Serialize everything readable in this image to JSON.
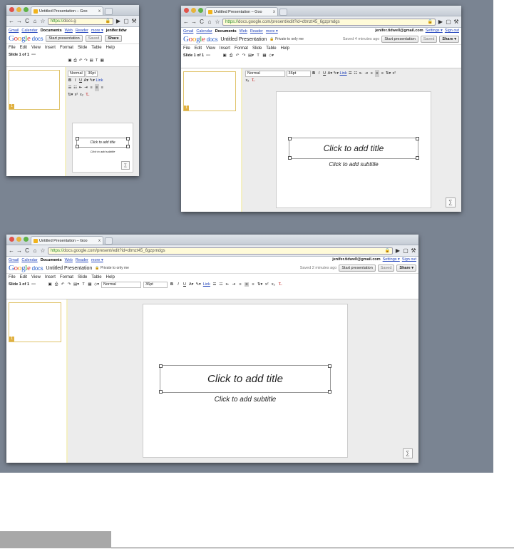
{
  "browser": {
    "tab_title": "Untitled Presentation – Goo",
    "tab_close": "x",
    "url_scheme": "https://",
    "url_short": "docs.g",
    "url_medium": "docs.google.com/present/edit?id=dtmzt45_6gzprndgs",
    "url_long": "docs.google.com/present/edit?id=dtmzt45_6gzprndgs"
  },
  "gbar": {
    "links": [
      "Gmail",
      "Calendar",
      "Documents",
      "Web",
      "Reader",
      "more ▾"
    ],
    "email": "jenifer.tidwell@gmail.com",
    "email_short": "jenifer.tidw",
    "settings": "Settings ▾",
    "sign_out": "Sign out"
  },
  "docs": {
    "logo_google": "Google",
    "logo_docs": "docs",
    "title": "Untitled Presentation",
    "private": "Private to only me",
    "saved_msg_w2": "Saved 4 minutes ago",
    "saved_msg_w3": "Saved 2 minutes ago",
    "start_btn": "Start presentation",
    "saved_btn": "Saved",
    "share_btn": "Share"
  },
  "menu": [
    "File",
    "Edit",
    "View",
    "Insert",
    "Format",
    "Slide",
    "Table",
    "Help"
  ],
  "toolbar": {
    "slide_counter": "Slide 1 of 1",
    "style": "Normal",
    "size": "36pt",
    "bold": "B",
    "italic": "I",
    "underline": "U",
    "link": "Link"
  },
  "slide": {
    "title": "Click to add title",
    "subtitle": "Click to add subtitle",
    "number": "1"
  }
}
